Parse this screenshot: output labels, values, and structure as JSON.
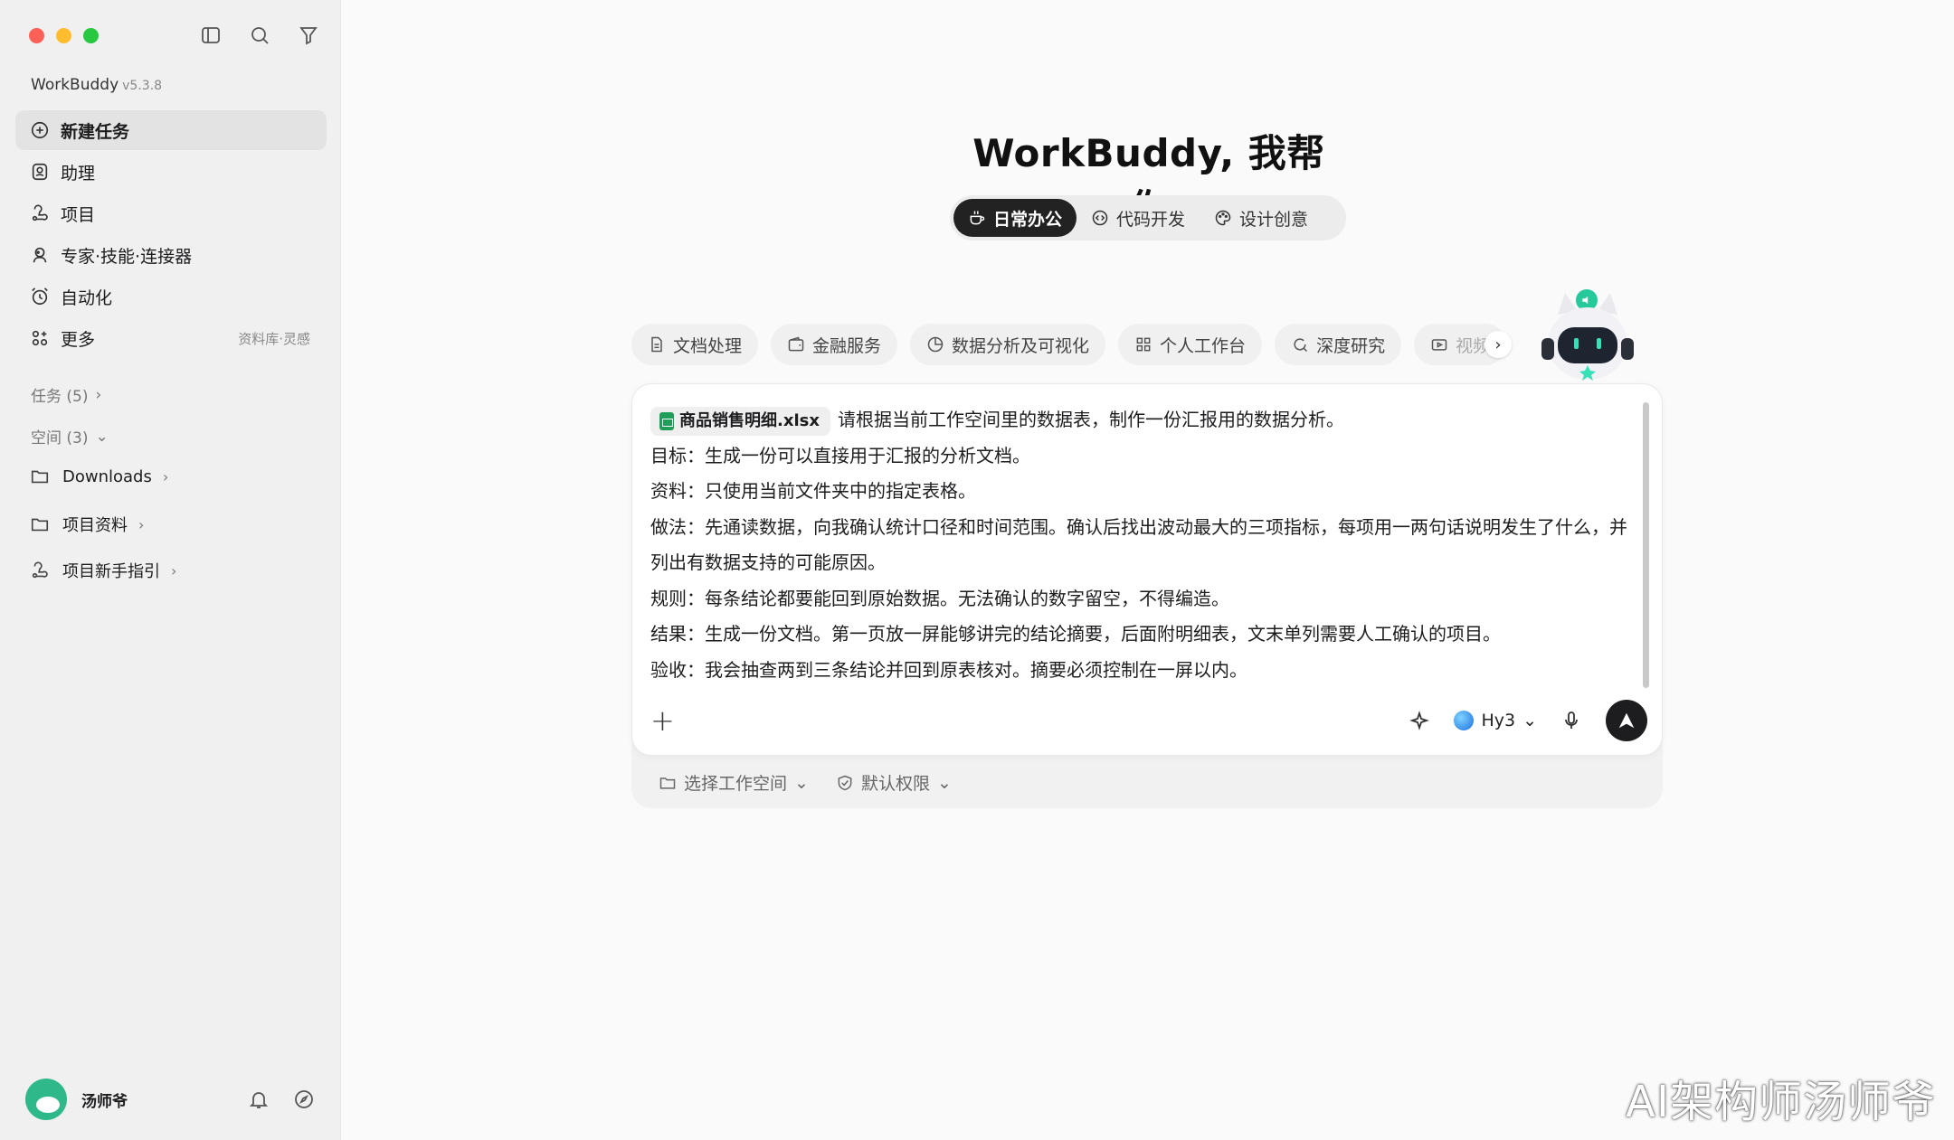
{
  "app": {
    "name": "WorkBuddy",
    "version": "v5.3.8"
  },
  "sidebar": {
    "items": [
      {
        "label": "新建任务",
        "icon": "plus-circle-icon"
      },
      {
        "label": "助理",
        "icon": "assistant-icon"
      },
      {
        "label": "项目",
        "icon": "project-icon"
      },
      {
        "label": "专家·技能·连接器",
        "icon": "expert-icon"
      },
      {
        "label": "自动化",
        "icon": "alarm-clock-icon"
      },
      {
        "label": "更多",
        "icon": "apps-icon",
        "sub": "资料库·灵感"
      }
    ],
    "tasks_label": "任务 (5)",
    "spaces_label": "空间 (3)",
    "folders": [
      "Downloads",
      "项目资料",
      "项目新手指引"
    ],
    "user": {
      "name": "汤师爷"
    }
  },
  "main": {
    "title": "WorkBuddy, 我帮你",
    "mode_tabs": [
      "日常办公",
      "代码开发",
      "设计创意"
    ],
    "categories": [
      "文档处理",
      "金融服务",
      "数据分析及可视化",
      "个人工作台",
      "深度研究",
      "视频"
    ],
    "composer": {
      "file_name": "商品销售明细.xlsx",
      "lines": [
        "请根据当前工作空间里的数据表，制作一份汇报用的数据分析。",
        "目标：生成一份可以直接用于汇报的分析文档。",
        "资料：只使用当前文件夹中的指定表格。",
        "做法：先通读数据，向我确认统计口径和时间范围。确认后找出波动最大的三项指标，每项用一两句话说明发生了什么，并列出有数据支持的可能原因。",
        "规则：每条结论都要能回到原始数据。无法确认的数字留空，不得编造。",
        "结果：生成一份文档。第一页放一屏能够讲完的结论摘要，后面附明细表，文末单列需要人工确认的项目。",
        "验收：我会抽查两到三条结论并回到原表核对。摘要必须控制在一屏以内。"
      ],
      "model": "Hy3"
    },
    "options": {
      "workspace": "选择工作空间",
      "permission": "默认权限"
    }
  },
  "watermark": "AI架构师汤师爷"
}
